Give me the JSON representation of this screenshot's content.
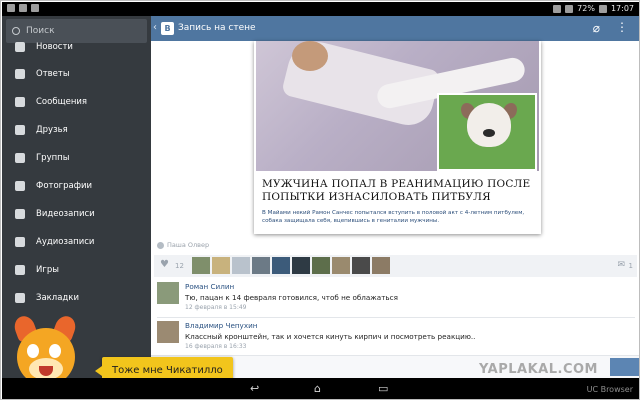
{
  "status_bar": {
    "battery": "72%",
    "time": "17:07"
  },
  "sidebar": {
    "search_placeholder": "Поиск",
    "items": [
      {
        "label": "Новости",
        "icon": "news-icon"
      },
      {
        "label": "Ответы",
        "icon": "answers-icon"
      },
      {
        "label": "Сообщения",
        "icon": "messages-icon"
      },
      {
        "label": "Друзья",
        "icon": "friends-icon"
      },
      {
        "label": "Группы",
        "icon": "groups-icon"
      },
      {
        "label": "Фотографии",
        "icon": "photos-icon"
      },
      {
        "label": "Видеозаписи",
        "icon": "videos-icon"
      },
      {
        "label": "Аудиозаписи",
        "icon": "audio-icon"
      },
      {
        "label": "Игры",
        "icon": "games-icon"
      },
      {
        "label": "Закладки",
        "icon": "bookmarks-icon"
      }
    ]
  },
  "header": {
    "app_icon": "В",
    "title": "Запись на стене"
  },
  "post": {
    "headline": "МУЖЧИНА ПОПАЛ В РЕАНИМАЦИЮ ПОСЛЕ ПОПЫТКИ ИЗНАСИЛОВАТЬ ПИТБУЛЯ",
    "lead": "В Майами некий Рамон Санчес попытался вступить в половой акт с 4-летним питбулем, собака защищала себя, вцепившись в гениталии мужчины.",
    "author": "Паша Олвер",
    "likes": "12",
    "reposts": "1"
  },
  "comments": [
    {
      "name": "Роман Силин",
      "text": "Тю, пацан к 14 февраля готовился, чтоб не облажаться",
      "date": "12 февраля в 15:49"
    },
    {
      "name": "Владимир Чепухин",
      "text": "Классный кронштейн, так и хочется кинуть кирпич и посмотреть реакцию..",
      "date": "16 февраля в 16:33"
    }
  ],
  "overlay": {
    "speech": "Тоже мне Чикатилло",
    "watermark": "YAPLAKAL.COM"
  },
  "nav_bar": {
    "browser": "UC Browser"
  },
  "colors": {
    "header_blue": "#4f76a0",
    "sidebar_dark": "#353a3f",
    "speech_yellow": "#f2c51c"
  }
}
